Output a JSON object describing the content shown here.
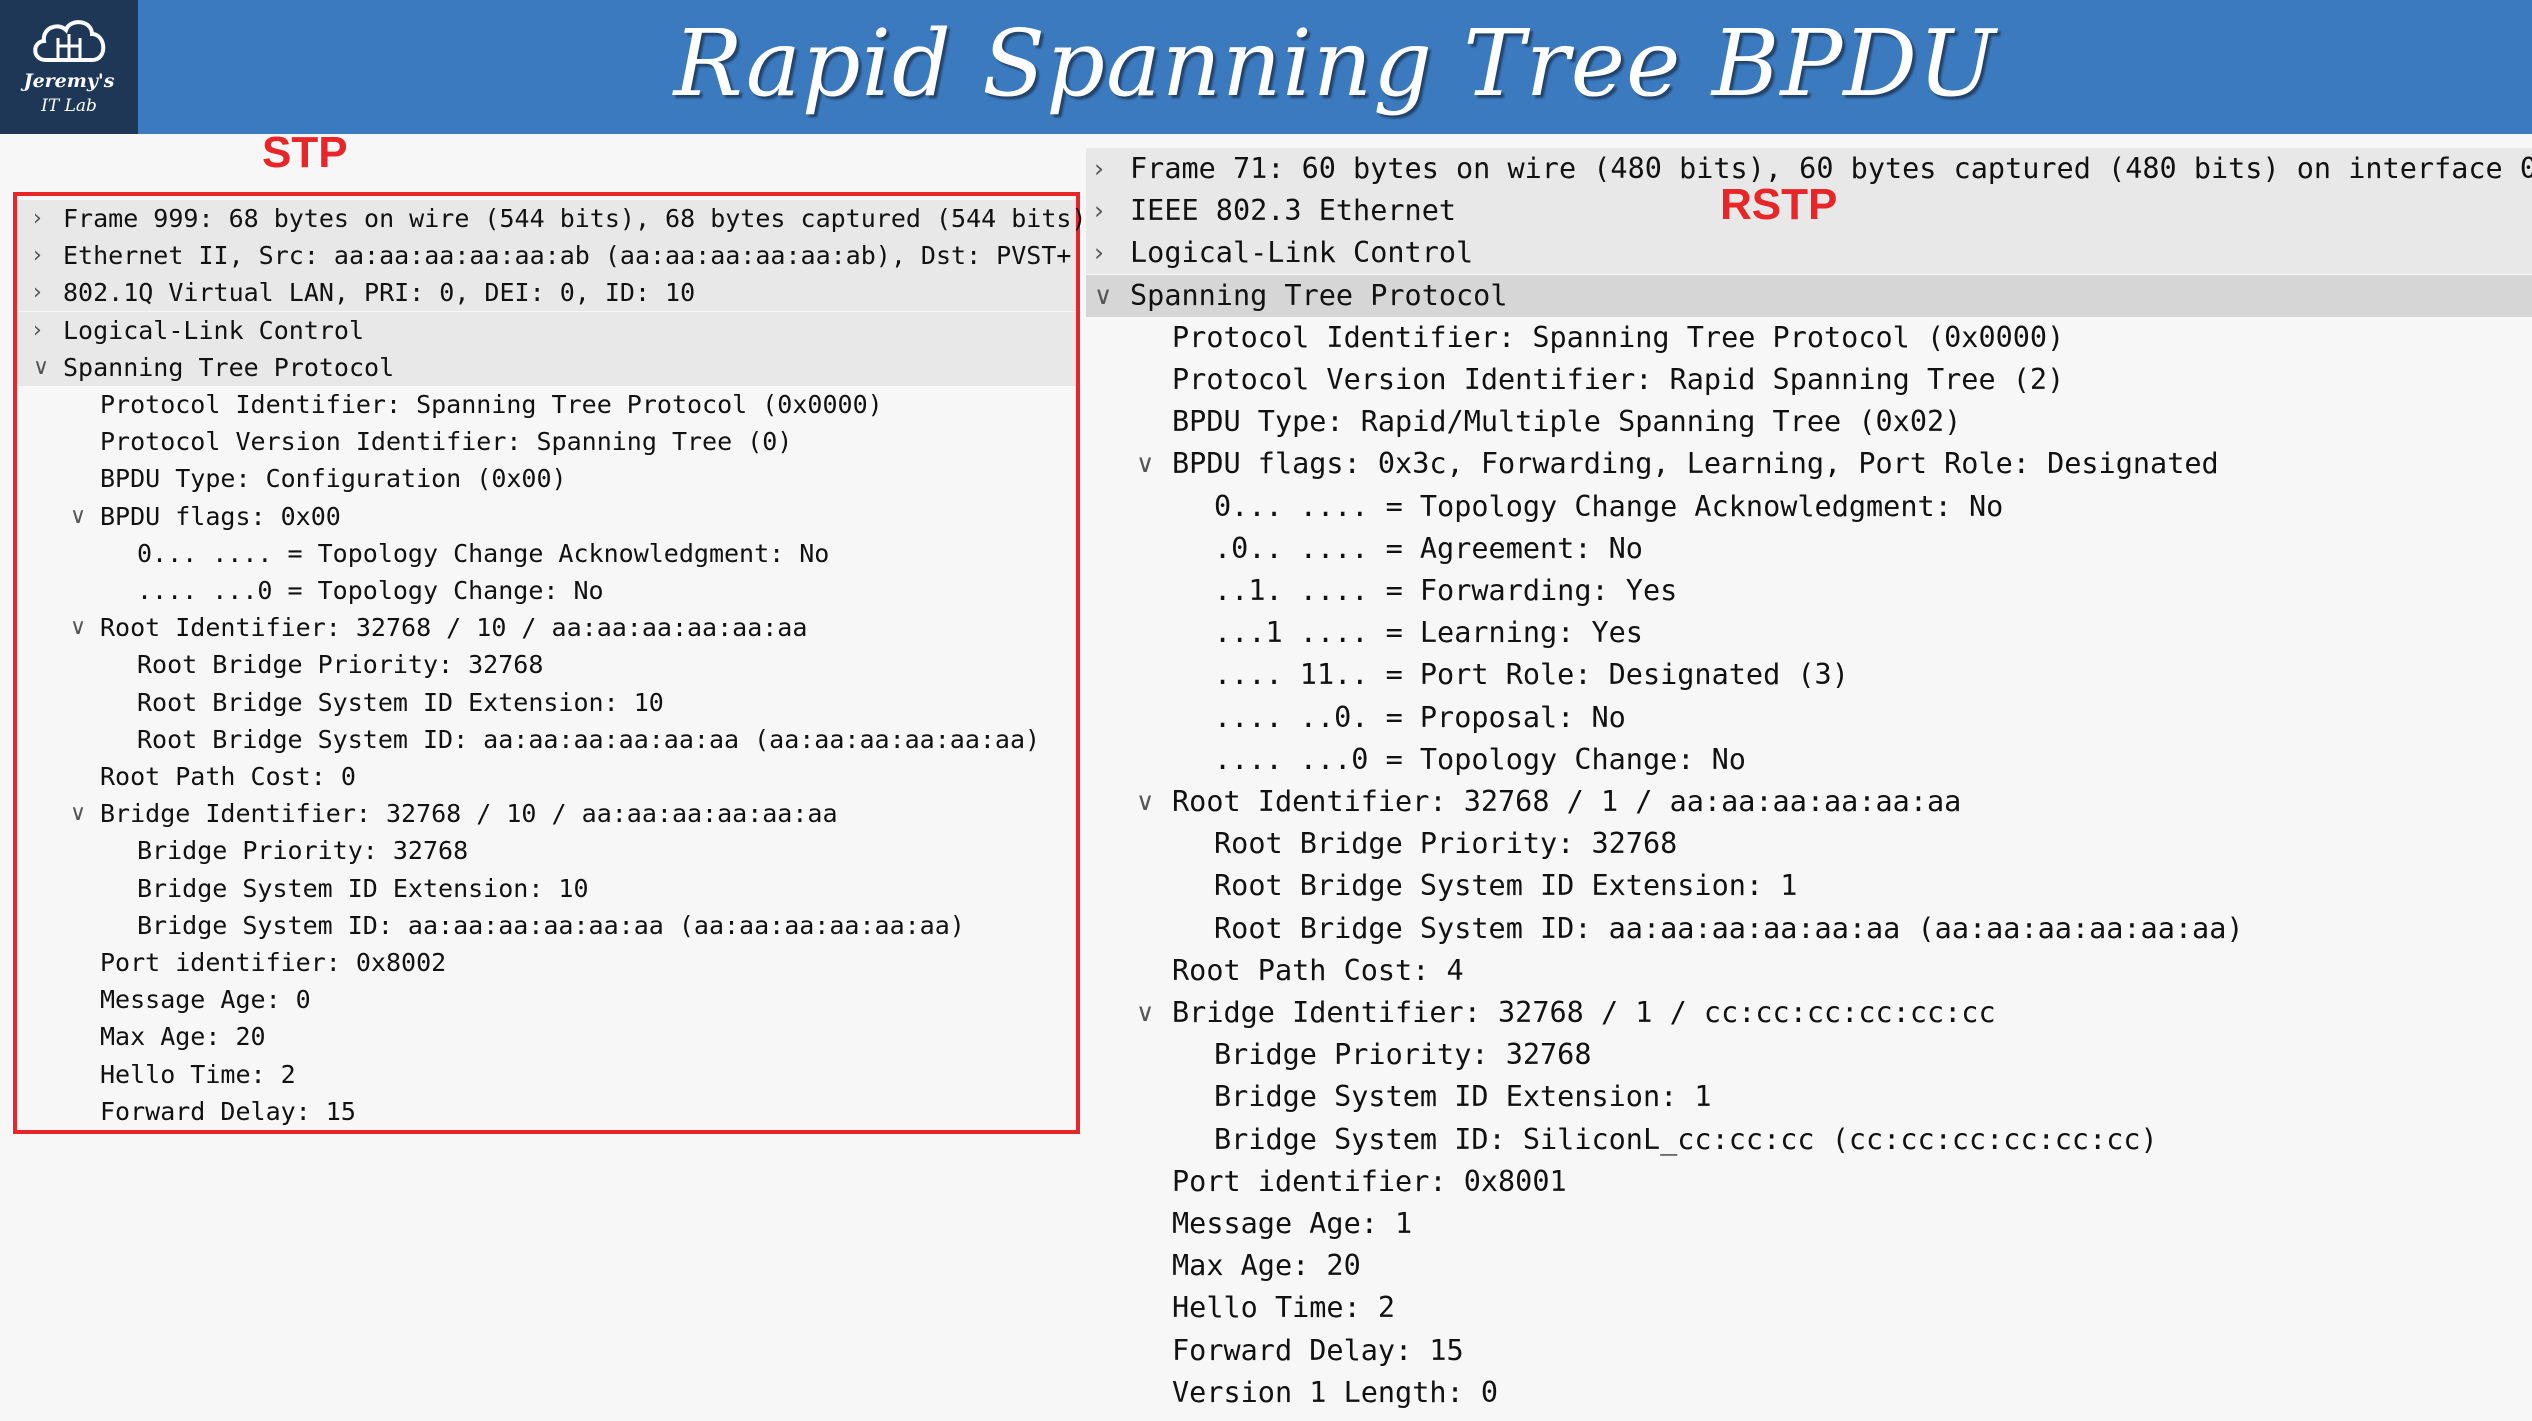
{
  "header": {
    "title": "Rapid Spanning Tree BPDU",
    "logo_line1": "Jeremy's",
    "logo_line2": "IT Lab"
  },
  "labels": {
    "stp": "STP",
    "rstp": "RSTP"
  },
  "colors": {
    "header_blue": "#3c7ac0",
    "logo_bg": "#1f3756",
    "highlight_red": "#e8262a"
  },
  "stp_tree": [
    {
      "text": "Frame 999: 68 bytes on wire (544 bits), 68 bytes captured (544 bits)",
      "arrow": "collapsed"
    },
    {
      "text": "Ethernet II, Src: aa:aa:aa:aa:aa:ab (aa:aa:aa:aa:aa:ab), Dst: PVST+",
      "arrow": "collapsed"
    },
    {
      "text": "802.1Q Virtual LAN, PRI: 0, DEI: 0, ID: 10",
      "arrow": "collapsed"
    },
    {
      "text": "Logical-Link Control",
      "arrow": "collapsed"
    },
    {
      "text": "Spanning Tree Protocol",
      "arrow": "expanded"
    },
    {
      "text": "Protocol Identifier: Spanning Tree Protocol (0x0000)"
    },
    {
      "text": "Protocol Version Identifier: Spanning Tree (0)"
    },
    {
      "text": "BPDU Type: Configuration (0x00)"
    },
    {
      "text": "BPDU flags: 0x00",
      "arrow": "expanded"
    },
    {
      "text": "0... .... = Topology Change Acknowledgment: No"
    },
    {
      "text": ".... ...0 = Topology Change: No"
    },
    {
      "text": "Root Identifier: 32768 / 10 / aa:aa:aa:aa:aa:aa",
      "arrow": "expanded"
    },
    {
      "text": "Root Bridge Priority: 32768"
    },
    {
      "text": "Root Bridge System ID Extension: 10"
    },
    {
      "text": "Root Bridge System ID: aa:aa:aa:aa:aa:aa (aa:aa:aa:aa:aa:aa)"
    },
    {
      "text": "Root Path Cost: 0"
    },
    {
      "text": "Bridge Identifier: 32768 / 10 / aa:aa:aa:aa:aa:aa",
      "arrow": "expanded"
    },
    {
      "text": "Bridge Priority: 32768"
    },
    {
      "text": "Bridge System ID Extension: 10"
    },
    {
      "text": "Bridge System ID: aa:aa:aa:aa:aa:aa (aa:aa:aa:aa:aa:aa)"
    },
    {
      "text": "Port identifier: 0x8002"
    },
    {
      "text": "Message Age: 0"
    },
    {
      "text": "Max Age: 20"
    },
    {
      "text": "Hello Time: 2"
    },
    {
      "text": "Forward Delay: 15"
    }
  ],
  "rstp_tree": [
    {
      "text": "Frame 71: 60 bytes on wire (480 bits), 60 bytes captured (480 bits) on interface 0",
      "arrow": "collapsed"
    },
    {
      "text": "IEEE 802.3 Ethernet",
      "arrow": "collapsed"
    },
    {
      "text": "Logical-Link Control",
      "arrow": "collapsed"
    },
    {
      "text": "Spanning Tree Protocol",
      "arrow": "expanded",
      "selected": true
    },
    {
      "text": "Protocol Identifier: Spanning Tree Protocol (0x0000)"
    },
    {
      "text": "Protocol Version Identifier: Rapid Spanning Tree (2)"
    },
    {
      "text": "BPDU Type: Rapid/Multiple Spanning Tree (0x02)"
    },
    {
      "text": "BPDU flags: 0x3c, Forwarding, Learning, Port Role: Designated",
      "arrow": "expanded"
    },
    {
      "text": "0... .... = Topology Change Acknowledgment: No"
    },
    {
      "text": ".0.. .... = Agreement: No"
    },
    {
      "text": "..1. .... = Forwarding: Yes"
    },
    {
      "text": "...1 .... = Learning: Yes"
    },
    {
      "text": ".... 11.. = Port Role: Designated (3)"
    },
    {
      "text": ".... ..0. = Proposal: No"
    },
    {
      "text": ".... ...0 = Topology Change: No"
    },
    {
      "text": "Root Identifier: 32768 / 1 / aa:aa:aa:aa:aa:aa",
      "arrow": "expanded"
    },
    {
      "text": "Root Bridge Priority: 32768"
    },
    {
      "text": "Root Bridge System ID Extension: 1"
    },
    {
      "text": "Root Bridge System ID: aa:aa:aa:aa:aa:aa (aa:aa:aa:aa:aa:aa)"
    },
    {
      "text": "Root Path Cost: 4"
    },
    {
      "text": "Bridge Identifier: 32768 / 1 / cc:cc:cc:cc:cc:cc",
      "arrow": "expanded"
    },
    {
      "text": "Bridge Priority: 32768"
    },
    {
      "text": "Bridge System ID Extension: 1"
    },
    {
      "text": "Bridge System ID: SiliconL_cc:cc:cc (cc:cc:cc:cc:cc:cc)"
    },
    {
      "text": "Port identifier: 0x8001"
    },
    {
      "text": "Message Age: 1"
    },
    {
      "text": "Max Age: 20"
    },
    {
      "text": "Hello Time: 2"
    },
    {
      "text": "Forward Delay: 15"
    },
    {
      "text": "Version 1 Length: 0"
    }
  ]
}
